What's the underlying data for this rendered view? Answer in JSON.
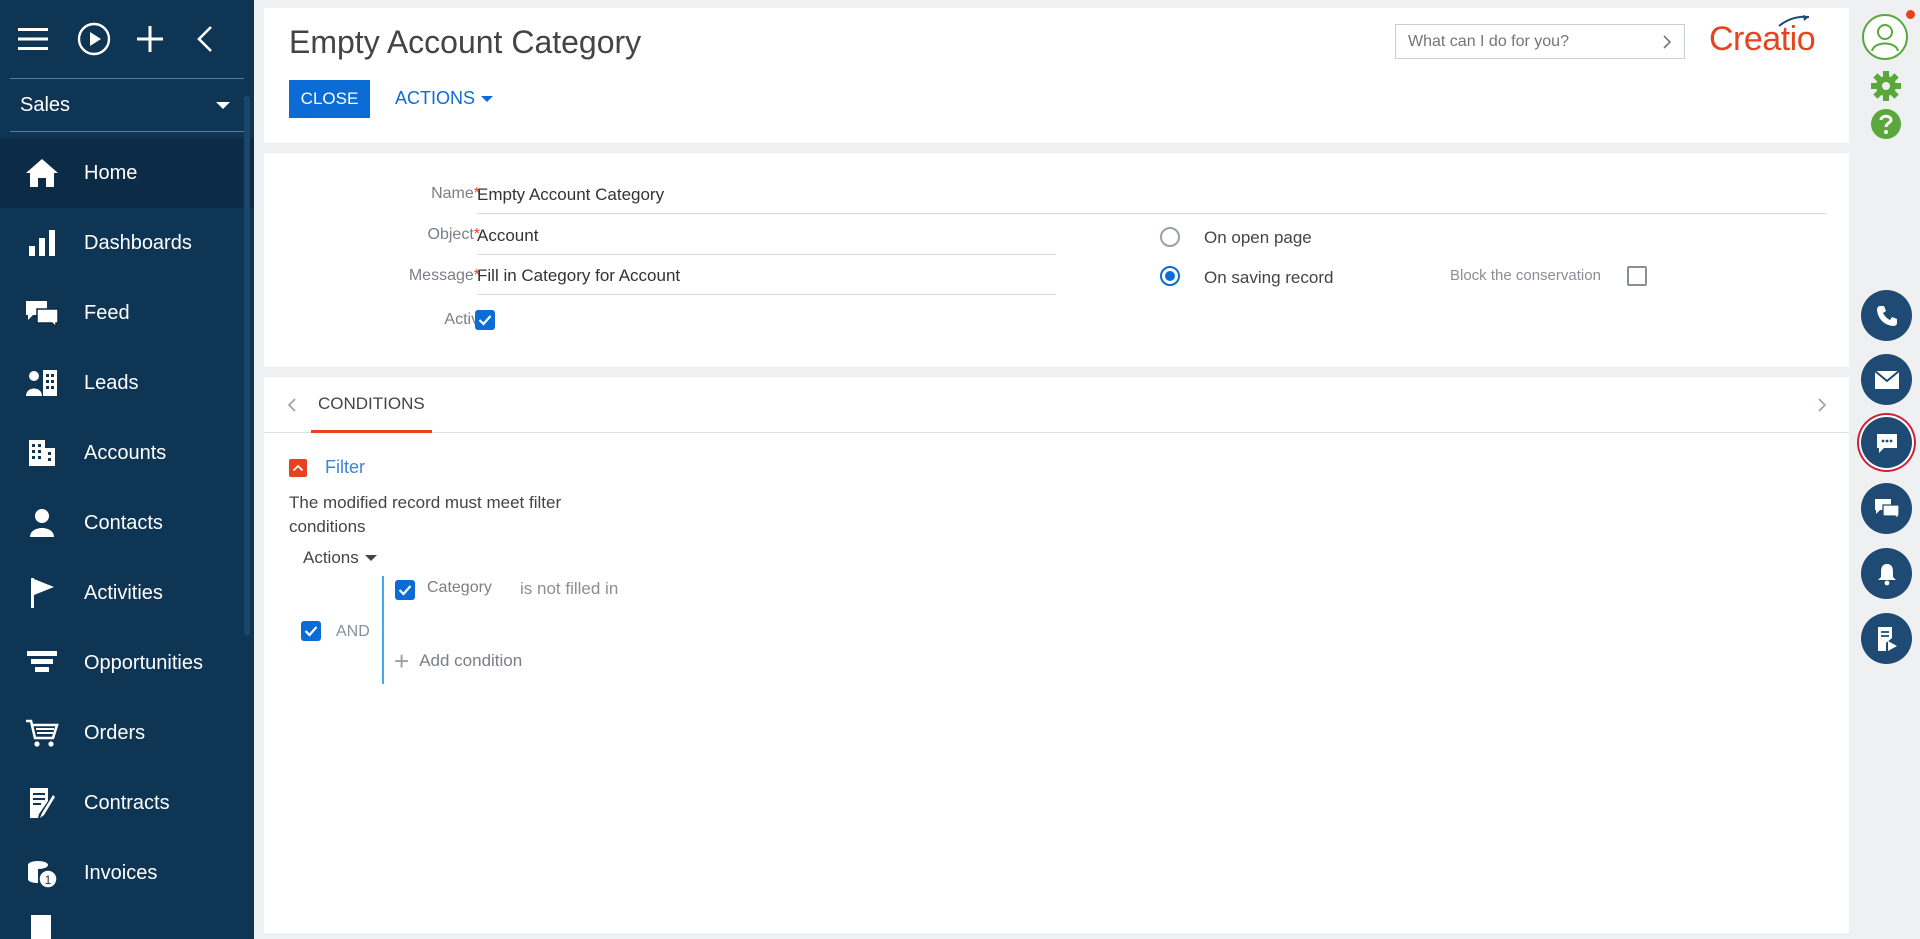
{
  "sidebar": {
    "workspace": "Sales",
    "items": [
      {
        "label": "Home",
        "icon": "home-icon",
        "active": true
      },
      {
        "label": "Dashboards",
        "icon": "bar-chart-icon"
      },
      {
        "label": "Feed",
        "icon": "feed-icon"
      },
      {
        "label": "Leads",
        "icon": "leads-icon"
      },
      {
        "label": "Accounts",
        "icon": "building-icon"
      },
      {
        "label": "Contacts",
        "icon": "person-icon"
      },
      {
        "label": "Activities",
        "icon": "flag-icon"
      },
      {
        "label": "Opportunities",
        "icon": "funnel-icon"
      },
      {
        "label": "Orders",
        "icon": "cart-icon"
      },
      {
        "label": "Contracts",
        "icon": "contract-icon"
      },
      {
        "label": "Invoices",
        "icon": "invoice-icon"
      }
    ]
  },
  "header": {
    "title": "Empty Account Category",
    "close_label": "CLOSE",
    "actions_label": "ACTIONS",
    "search_placeholder": "What can I do for you?",
    "logo_text": "Creatio"
  },
  "form": {
    "name_label": "Name",
    "name_value": "Empty Account Category",
    "object_label": "Object",
    "object_value": "Account",
    "message_label": "Message",
    "message_value": "Fill in Category for Account",
    "active_label": "Active",
    "active_checked": true,
    "on_open_label": "On open page",
    "on_saving_label": "On saving record",
    "selected_trigger": "On saving record",
    "block_label": "Block the conservation",
    "block_checked": false
  },
  "conditions": {
    "tab_label": "CONDITIONS",
    "filter_label": "Filter",
    "description": "The modified record must meet filter conditions",
    "actions_label": "Actions",
    "group_operator": "AND",
    "condition_field": "Category",
    "condition_operator": "is not filled in",
    "add_condition_label": "Add condition"
  },
  "colors": {
    "sidebar_bg": "#0f3555",
    "accent_blue": "#0c6cd6",
    "brand_red": "#e8431f",
    "rail_button": "#1f4a74",
    "green": "#5aa83c"
  }
}
